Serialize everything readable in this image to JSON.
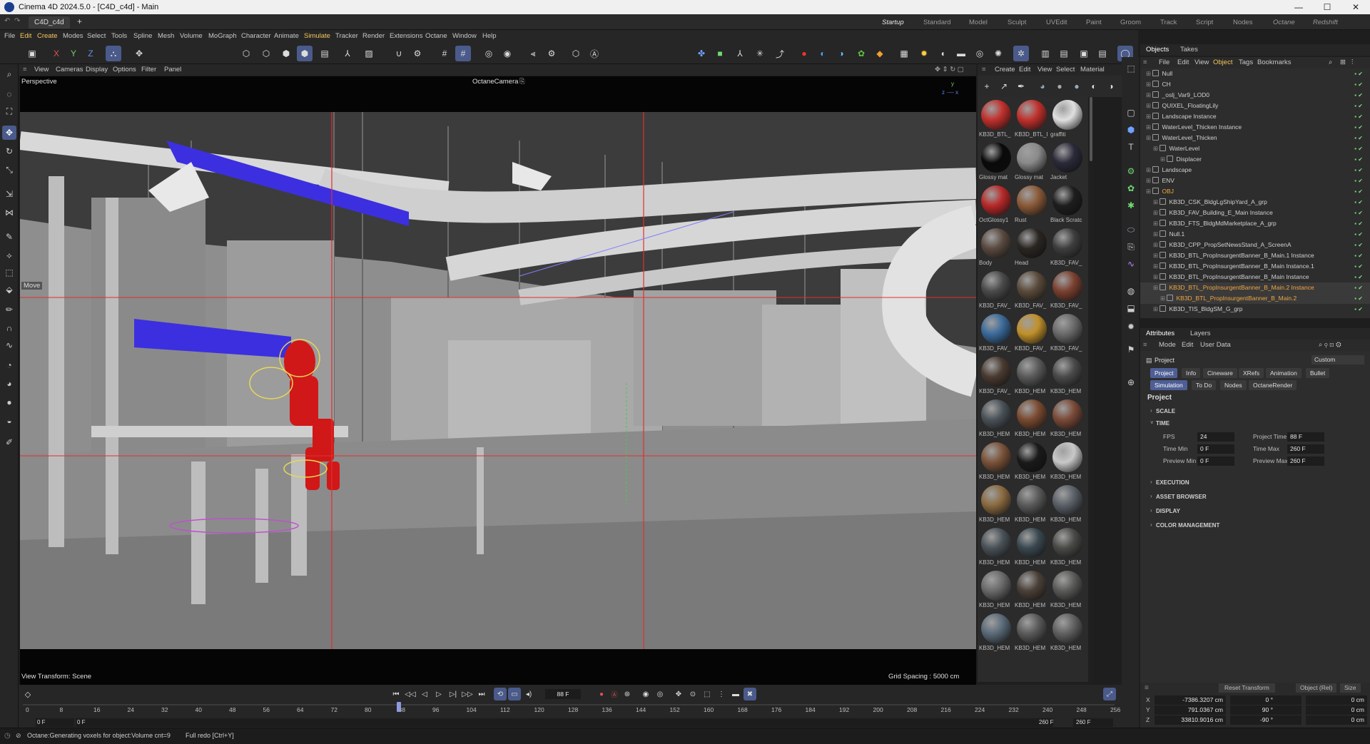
{
  "window": {
    "title": "Cinema 4D 2024.5.0 - [C4D_c4d] - Main",
    "minimize": "—",
    "maximize": "☐",
    "close": "✕"
  },
  "tabs": {
    "document": "C4D_c4d",
    "add": "+",
    "layouts": [
      "Startup",
      "Standard",
      "Model",
      "Sculpt",
      "UVEdit",
      "Paint",
      "Groom",
      "Track",
      "Script",
      "Nodes",
      "Octane",
      "Redshift"
    ],
    "active_layout": "Startup"
  },
  "menubar": [
    "File",
    "Edit",
    "Create",
    "Modes",
    "Select",
    "Tools",
    "Spline",
    "Mesh",
    "Volume",
    "MoGraph",
    "Character",
    "Animate",
    "Simulate",
    "Tracker",
    "Render",
    "Extensions",
    "Octane",
    "Window",
    "Help"
  ],
  "viewport": {
    "menu": [
      "View",
      "Cameras",
      "Display",
      "Options",
      "Filter",
      "Panel"
    ],
    "name": "Perspective",
    "camera": "OctaneCamera",
    "view_transform": "View Transform: Scene",
    "grid_spacing": "Grid Spacing : 5000 cm",
    "move_hint": "Move"
  },
  "materials": {
    "menu": [
      "Create",
      "Edit",
      "View",
      "Select",
      "Material"
    ],
    "items": [
      {
        "label": "KB3D_BTL_",
        "color": "#c0302c"
      },
      {
        "label": "KB3D_BTL_I",
        "color": "#c0302c"
      },
      {
        "label": "graffiti",
        "color": "#e0e0e0"
      },
      {
        "label": "Glossy mat",
        "color": "#0a0a0a"
      },
      {
        "label": "Glossy mat",
        "color": "#8a8a8a"
      },
      {
        "label": "Jacket",
        "color": "#2a2a3a"
      },
      {
        "label": "OctGlossy1",
        "color": "#b82828"
      },
      {
        "label": "Rust",
        "color": "#8a5a38"
      },
      {
        "label": "Black Scratc",
        "color": "#1e1e1e"
      },
      {
        "label": "Body",
        "color": "#5a4a40"
      },
      {
        "label": "Head",
        "color": "#2a2622"
      },
      {
        "label": "KB3D_FAV_",
        "color": "#3e3e3e"
      },
      {
        "label": "KB3D_FAV_",
        "color": "#4a4a4a"
      },
      {
        "label": "KB3D_FAV_",
        "color": "#5a4a3a"
      },
      {
        "label": "KB3D_FAV_",
        "color": "#7a4030"
      },
      {
        "label": "KB3D_FAV_",
        "color": "#3a6a9a"
      },
      {
        "label": "KB3D_FAV_",
        "color": "#c0902a"
      },
      {
        "label": "KB3D_FAV_",
        "color": "#6a6a6a"
      },
      {
        "label": "KB3D_FAV_",
        "color": "#4a3a30"
      },
      {
        "label": "KB3D_HEM",
        "color": "#5a5a5a"
      },
      {
        "label": "KB3D_HEM",
        "color": "#4a4a4a"
      },
      {
        "label": "KB3D_HEM",
        "color": "#4a5258"
      },
      {
        "label": "KB3D_HEM",
        "color": "#7a4a30"
      },
      {
        "label": "KB3D_HEM",
        "color": "#7a4a38"
      },
      {
        "label": "KB3D_HEM",
        "color": "#7a5238"
      },
      {
        "label": "KB3D_HEM",
        "color": "#1a1a1a"
      },
      {
        "label": "KB3D_HEM",
        "color": "#c8c8c8"
      },
      {
        "label": "KB3D_HEM",
        "color": "#8a6a40"
      },
      {
        "label": "KB3D_HEM",
        "color": "#5a5a5a"
      },
      {
        "label": "KB3D_HEM",
        "color": "#5a6068"
      },
      {
        "label": "KB3D_HEM",
        "color": "#4a5258"
      },
      {
        "label": "KB3D_HEM",
        "color": "#3a4850"
      },
      {
        "label": "KB3D_HEM",
        "color": "#4a4a48"
      },
      {
        "label": "KB3D_HEM",
        "color": "#6a6a6a"
      },
      {
        "label": "KB3D_HEM",
        "color": "#4a4038"
      },
      {
        "label": "KB3D_HEM",
        "color": "#5a5a58"
      },
      {
        "label": "KB3D_HEM",
        "color": "#5a6a78"
      },
      {
        "label": "KB3D_HEM",
        "color": "#5a5a5a"
      },
      {
        "label": "KB3D_HEM",
        "color": "#606060"
      }
    ]
  },
  "objects": {
    "tabs": [
      "Objects",
      "Takes"
    ],
    "menu": [
      "File",
      "Edit",
      "View",
      "Object",
      "Tags",
      "Bookmarks"
    ],
    "rows": [
      {
        "name": "Null",
        "indent": 0,
        "style": ""
      },
      {
        "name": "CH",
        "indent": 0,
        "style": ""
      },
      {
        "name": "_oslj_Var9_LOD0",
        "indent": 0,
        "style": ""
      },
      {
        "name": "QUIXEL_FloatingLily",
        "indent": 0,
        "style": ""
      },
      {
        "name": "Landscape Instance",
        "indent": 0,
        "style": ""
      },
      {
        "name": "WaterLevel_Thicken Instance",
        "indent": 0,
        "style": ""
      },
      {
        "name": "WaterLevel_Thicken",
        "indent": 0,
        "style": ""
      },
      {
        "name": "WaterLevel",
        "indent": 1,
        "style": ""
      },
      {
        "name": "Displacer",
        "indent": 2,
        "style": ""
      },
      {
        "name": "Landscape",
        "indent": 0,
        "style": ""
      },
      {
        "name": "ENV",
        "indent": 0,
        "style": ""
      },
      {
        "name": "OBJ",
        "indent": 0,
        "style": "orange"
      },
      {
        "name": "KB3D_CSK_BldgLgShipYard_A_grp",
        "indent": 1,
        "style": ""
      },
      {
        "name": "KB3D_FAV_Building_E_Main Instance",
        "indent": 1,
        "style": ""
      },
      {
        "name": "KB3D_FTS_BldgMdMarketplace_A_grp",
        "indent": 1,
        "style": ""
      },
      {
        "name": "Null.1",
        "indent": 1,
        "style": ""
      },
      {
        "name": "KB3D_CPP_PropSetNewsStand_A_ScreenA",
        "indent": 1,
        "style": ""
      },
      {
        "name": "KB3D_BTL_PropInsurgentBanner_B_Main.1 Instance",
        "indent": 1,
        "style": ""
      },
      {
        "name": "KB3D_BTL_PropInsurgentBanner_B_Main Instance.1",
        "indent": 1,
        "style": ""
      },
      {
        "name": "KB3D_BTL_PropInsurgentBanner_B_Main Instance",
        "indent": 1,
        "style": ""
      },
      {
        "name": "KB3D_BTL_PropInsurgentBanner_B_Main.2 Instance",
        "indent": 1,
        "style": "orange"
      },
      {
        "name": "KB3D_BTL_PropInsurgentBanner_B_Main.2",
        "indent": 2,
        "style": "orange"
      },
      {
        "name": "KB3D_TIS_BldgSM_G_grp",
        "indent": 1,
        "style": ""
      }
    ]
  },
  "attributes": {
    "tabs": [
      "Attributes",
      "Layers"
    ],
    "menu": [
      "Mode",
      "Edit",
      "User Data"
    ],
    "title": "Project",
    "preset": "Custom",
    "prop_tabs": [
      "Project",
      "Info",
      "Cineware",
      "XRefs",
      "Animation",
      "Bullet",
      "Simulation",
      "To Do",
      "Nodes",
      "OctaneRender"
    ],
    "section_title": "Project",
    "sections": {
      "scale": "SCALE",
      "time": "TIME",
      "execution": "EXECUTION",
      "asset_browser": "ASSET BROWSER",
      "display": "DISPLAY",
      "color_management": "COLOR MANAGEMENT"
    },
    "fields": {
      "fps_label": "FPS",
      "fps": "24",
      "project_time_label": "Project Time",
      "project_time": "88 F",
      "time_min_label": "Time Min",
      "time_min": "0 F",
      "time_max_label": "Time Max",
      "time_max": "260 F",
      "preview_min_label": "Preview Min",
      "preview_min": "0 F",
      "preview_max_label": "Preview Max",
      "preview_max": "260 F"
    }
  },
  "coordinates": {
    "reset": "Reset Transform",
    "mode": "Object (Rel)",
    "size": "Size",
    "x_label": "X",
    "y_label": "Y",
    "z_label": "Z",
    "x": "-7386.3207 cm",
    "y": "791.0367 cm",
    "z": "33810.9016 cm",
    "h": "0 °",
    "p": "90 °",
    "b": "-90 °",
    "sx": "0 cm",
    "sy": "0 cm",
    "sz": "0 cm"
  },
  "timeline": {
    "current_frame": "88 F",
    "start": "0 F",
    "start2": "0 F",
    "end": "260 F",
    "end2": "260 F",
    "ticks": [
      "0",
      "8",
      "16",
      "24",
      "32",
      "40",
      "48",
      "56",
      "64",
      "72",
      "80",
      "88",
      "96",
      "104",
      "112",
      "120",
      "128",
      "136",
      "144",
      "152",
      "160",
      "168",
      "176",
      "184",
      "192",
      "200",
      "208",
      "216",
      "224",
      "232",
      "240",
      "248",
      "256"
    ]
  },
  "status": {
    "message": "Octane:Generating voxels for object:Volume  cnt=9",
    "hint": "Full redo [Ctrl+Y]"
  },
  "colors": {
    "accent": "#4a5a8a",
    "selection_orange": "#f0a640",
    "banner_blue": "#3c2fe0",
    "character_red": "#d01818"
  }
}
